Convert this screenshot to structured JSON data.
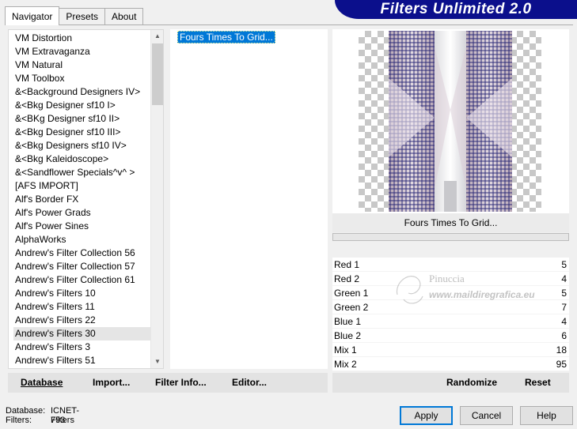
{
  "tabs": [
    {
      "label": "Navigator",
      "active": true
    },
    {
      "label": "Presets",
      "active": false
    },
    {
      "label": "About",
      "active": false
    }
  ],
  "banner": {
    "title": "Filters Unlimited 2.0"
  },
  "categories": [
    "VM Distortion",
    "VM Extravaganza",
    "VM Natural",
    "VM Toolbox",
    "&<Background Designers IV>",
    "&<Bkg Designer sf10 I>",
    "&<BKg Designer sf10 II>",
    "&<Bkg Designer sf10 III>",
    "&<Bkg Designers sf10 IV>",
    "&<Bkg Kaleidoscope>",
    "&<Sandflower Specials^v^ >",
    "[AFS IMPORT]",
    "Alf's Border FX",
    "Alf's Power Grads",
    "Alf's Power Sines",
    "AlphaWorks",
    "Andrew's Filter Collection 56",
    "Andrew's Filter Collection 57",
    "Andrew's Filter Collection 61",
    "Andrew's Filters 10",
    "Andrew's Filters 11",
    "Andrew's Filters 22",
    "Andrew's Filters 30",
    "Andrew's Filters 3",
    "Andrew's Filters 51"
  ],
  "selected_category_index": 22,
  "filters": [
    "Fours Times To Grid..."
  ],
  "current_filter": "Fours Times To Grid...",
  "params": [
    {
      "label": "Red 1",
      "value": "5"
    },
    {
      "label": "Red 2",
      "value": "4"
    },
    {
      "label": "Green 1",
      "value": "5"
    },
    {
      "label": "Green 2",
      "value": "7"
    },
    {
      "label": "Blue 1",
      "value": "4"
    },
    {
      "label": "Blue 2",
      "value": "6"
    },
    {
      "label": "Mix 1",
      "value": "18"
    },
    {
      "label": "Mix 2",
      "value": "95"
    }
  ],
  "watermark": {
    "line1": "Pinuccia",
    "line2": "www.maildiregrafica.eu"
  },
  "toolbar": {
    "database": "Database",
    "import": "Import...",
    "filter_info": "Filter Info...",
    "editor": "Editor...",
    "randomize": "Randomize",
    "reset": "Reset"
  },
  "db_info": {
    "database_label": "Database:",
    "database_value": "ICNET-Filters",
    "filters_label": "Filters:",
    "filters_value": "793"
  },
  "buttons": {
    "apply": "Apply",
    "cancel": "Cancel",
    "help": "Help"
  },
  "colors": {
    "selection": "#0078d7",
    "banner": "#0b0f8c",
    "grid": "#1a1a6e",
    "preview_tint": "#c9b8c4"
  }
}
